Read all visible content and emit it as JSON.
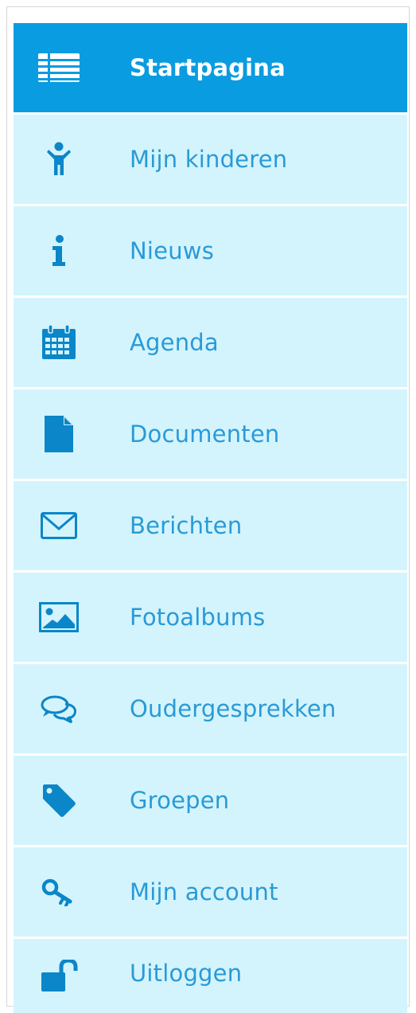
{
  "colors": {
    "active_background": "#0a9ce0",
    "item_background": "#d3f4fd",
    "text": "#2a9ad6",
    "active_text": "#ffffff"
  },
  "menu": {
    "items": [
      {
        "label": "Startpagina",
        "icon": "list-icon",
        "active": true
      },
      {
        "label": "Mijn kinderen",
        "icon": "child-icon"
      },
      {
        "label": "Nieuws",
        "icon": "info-icon"
      },
      {
        "label": "Agenda",
        "icon": "calendar-icon"
      },
      {
        "label": "Documenten",
        "icon": "document-icon"
      },
      {
        "label": "Berichten",
        "icon": "envelope-icon"
      },
      {
        "label": "Fotoalbums",
        "icon": "photo-icon"
      },
      {
        "label": "Oudergesprekken",
        "icon": "chat-icon"
      },
      {
        "label": "Groepen",
        "icon": "tag-icon"
      },
      {
        "label": "Mijn account",
        "icon": "key-icon"
      },
      {
        "label": "Uitloggen",
        "icon": "unlock-icon"
      }
    ]
  }
}
